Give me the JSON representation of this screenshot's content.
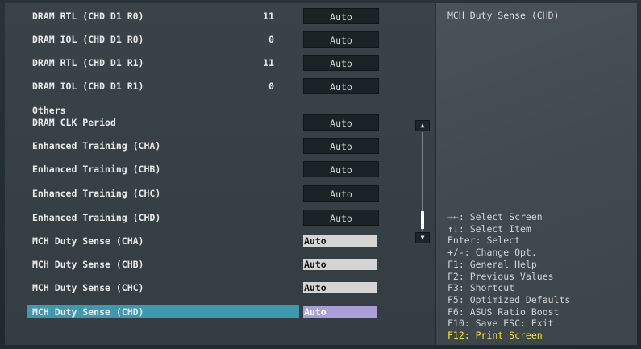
{
  "settings_top": [
    {
      "label": "DRAM RTL (CHD D1 R0)",
      "value": "11",
      "button": "Auto"
    },
    {
      "label": "DRAM IOL (CHD D1 R0)",
      "value": "0",
      "button": "Auto"
    },
    {
      "label": "DRAM RTL (CHD D1 R1)",
      "value": "11",
      "button": "Auto"
    },
    {
      "label": "DRAM IOL (CHD D1 R1)",
      "value": "0",
      "button": "Auto"
    }
  ],
  "section_title": "Others",
  "settings_others": [
    {
      "label": "DRAM CLK Period",
      "button": "Auto"
    },
    {
      "label": "Enhanced Training (CHA)",
      "button": "Auto"
    },
    {
      "label": "Enhanced Training (CHB)",
      "button": "Auto"
    },
    {
      "label": "Enhanced Training (CHC)",
      "button": "Auto"
    },
    {
      "label": "Enhanced Training (CHD)",
      "button": "Auto"
    }
  ],
  "settings_duty": [
    {
      "label": "MCH Duty Sense (CHA)",
      "field": "Auto"
    },
    {
      "label": "MCH Duty Sense (CHB)",
      "field": "Auto"
    },
    {
      "label": "MCH Duty Sense (CHC)",
      "field": "Auto"
    },
    {
      "label": "MCH Duty Sense (CHD)",
      "field": "Auto",
      "selected": true
    }
  ],
  "help": {
    "title": "MCH Duty Sense (CHD)"
  },
  "keys": [
    "→←: Select Screen",
    "↑↓: Select Item",
    "Enter: Select",
    "+/-: Change Opt.",
    "F1: General Help",
    "F2: Previous Values",
    "F3: Shortcut",
    "F5: Optimized Defaults",
    "F6: ASUS Ratio Boost",
    "F10: Save  ESC: Exit",
    "F12: Print Screen"
  ],
  "scroll": {
    "up_icon": "▲",
    "down_icon": "▼"
  },
  "colors": {
    "selected_row": "#3f98b0",
    "selected_field": "#a99ed8",
    "f12_key": "#f6e23a"
  }
}
